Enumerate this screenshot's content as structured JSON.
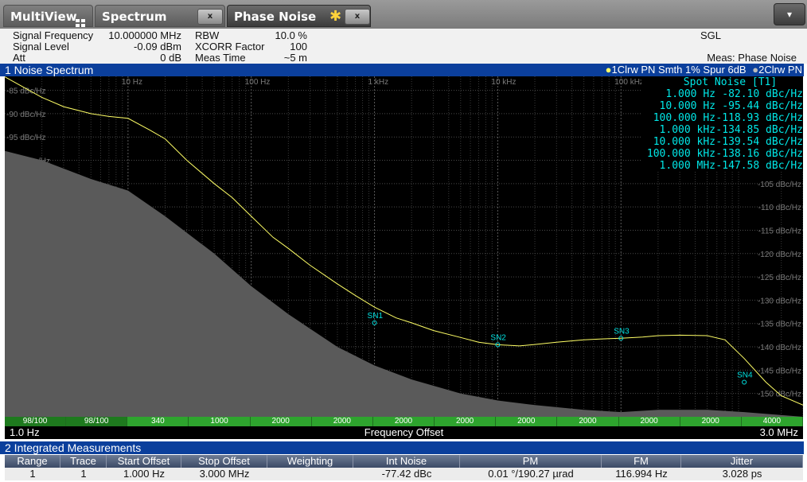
{
  "tabs": {
    "multiview": "MultiView",
    "multiview_icon": "grid-icon",
    "spectrum": "Spectrum",
    "phase_noise": "Phase Noise",
    "close_symbol": "x",
    "modified_icon": "asterisk-icon",
    "dropdown_symbol": "▾"
  },
  "info": {
    "signal_frequency_label": "Signal Frequency",
    "signal_frequency_value": "10.000000 MHz",
    "signal_level_label": "Signal Level",
    "signal_level_value": "-0.09 dBm",
    "att_label": "Att",
    "att_value": "0 dB",
    "rbw_label": "RBW",
    "rbw_value": "10.0 %",
    "xcorr_label": "XCORR Factor",
    "xcorr_value": "100",
    "meas_time_label": "Meas Time",
    "meas_time_value": "~5 m",
    "sweep_mode": "SGL",
    "meas_label": "Meas: Phase Noise"
  },
  "noise_window": {
    "title": "1 Noise Spectrum",
    "trace1_label": "1Clrw PN Smth 1% Spur 6dB",
    "trace2_label": "2Clrw PN"
  },
  "spot_noise": {
    "title": "Spot Noise [T1]",
    "rows": [
      {
        "offset": "1.000 Hz",
        "value": "-82.10 dBc/Hz"
      },
      {
        "offset": "10.000 Hz",
        "value": "-95.44 dBc/Hz"
      },
      {
        "offset": "100.000 Hz",
        "value": "-118.93 dBc/Hz"
      },
      {
        "offset": "1.000 kHz",
        "value": "-134.85 dBc/Hz"
      },
      {
        "offset": "10.000 kHz",
        "value": "-139.54 dBc/Hz"
      },
      {
        "offset": "100.000 kHz",
        "value": "-138.16 dBc/Hz"
      },
      {
        "offset": "1.000 MHz",
        "value": "-147.58 dBc/Hz"
      }
    ]
  },
  "rbw_bar": [
    "98/100",
    "98/100",
    "340",
    "1000",
    "2000",
    "2000",
    "2000",
    "2000",
    "2000",
    "2000",
    "2000",
    "2000",
    "4000"
  ],
  "footer": {
    "start": "1.0 Hz",
    "center": "Frequency Offset",
    "stop": "3.0 MHz"
  },
  "integrated": {
    "title": "2 Integrated Measurements",
    "columns": [
      "Range",
      "Trace",
      "Start Offset",
      "Stop Offset",
      "Weighting",
      "Int Noise",
      "PM",
      "FM",
      "Jitter"
    ],
    "rows": [
      [
        "1",
        "1",
        "1.000 Hz",
        "3.000 MHz",
        "",
        "-77.42 dBc",
        "0.01 °/190.27 µrad",
        "116.994 Hz",
        "3.028 ps"
      ]
    ]
  },
  "colors": {
    "trace1": "#ffff66",
    "noise_floor": "#5a5a5a",
    "marker": "#00e0e0",
    "title_bar": "#0b3f9c",
    "rbw_bar": "#2ea42e"
  },
  "chart_data": {
    "type": "line",
    "xscale": "log",
    "xlim": [
      1,
      3000000
    ],
    "ylim": [
      -155,
      -82
    ],
    "x_tick_labels": [
      "10 Hz",
      "100 Hz",
      "1 kHz",
      "10 kHz",
      "100 kHz"
    ],
    "x_tick_values": [
      10,
      100,
      1000,
      10000,
      100000
    ],
    "y_tick_labels": [
      "-85 dBc/Hz",
      "-90 dBc/Hz",
      "-95 dBc/Hz",
      "-100 dBc/Hz",
      "-105 dBc/Hz",
      "-110 dBc/Hz",
      "-115 dBc/Hz",
      "-120 dBc/Hz",
      "-125 dBc/Hz",
      "-130 dBc/Hz",
      "-135 dBc/Hz",
      "-140 dBc/Hz",
      "-145 dBc/Hz",
      "-150 dBc/Hz"
    ],
    "y_tick_values": [
      -85,
      -90,
      -95,
      -100,
      -105,
      -110,
      -115,
      -120,
      -125,
      -130,
      -135,
      -140,
      -145,
      -150
    ],
    "xlabel": "Frequency Offset",
    "series": [
      {
        "name": "1Clrw PN Smth 1% Spur 6dB",
        "x": [
          1,
          2,
          3,
          5,
          7,
          10,
          15,
          20,
          30,
          50,
          70,
          100,
          150,
          200,
          300,
          500,
          700,
          1000,
          1500,
          2000,
          3000,
          5000,
          7000,
          10000,
          15000,
          20000,
          30000,
          50000,
          70000,
          100000,
          150000,
          200000,
          300000,
          500000,
          700000,
          1000000,
          1500000,
          2000000,
          3000000
        ],
        "y": [
          -82.1,
          -86.5,
          -88.5,
          -90.0,
          -90.6,
          -91.0,
          -93.5,
          -95.4,
          -100.0,
          -105.0,
          -108.0,
          -112.0,
          -116.5,
          -118.9,
          -122.5,
          -126.5,
          -129.0,
          -131.5,
          -133.8,
          -134.85,
          -136.5,
          -138.0,
          -139.0,
          -139.54,
          -139.8,
          -139.5,
          -139.0,
          -138.5,
          -138.3,
          -138.16,
          -137.9,
          -137.6,
          -137.5,
          -137.6,
          -138.5,
          -142.5,
          -147.58,
          -150.5,
          -152.5
        ]
      },
      {
        "name": "noise floor",
        "x": [
          1,
          2,
          5,
          10,
          20,
          50,
          100,
          200,
          500,
          1000,
          2000,
          5000,
          10000,
          20000,
          50000,
          100000,
          200000,
          500000,
          1000000,
          3000000
        ],
        "y": [
          -98,
          -100,
          -104,
          -106.5,
          -112,
          -120,
          -127,
          -133,
          -140,
          -144,
          -147,
          -150,
          -151.5,
          -152.5,
          -153.5,
          -154,
          -153.5,
          -153.5,
          -154,
          -155
        ]
      }
    ],
    "markers": [
      {
        "label": "SN1",
        "x": 1000,
        "y": -134.85
      },
      {
        "label": "SN2",
        "x": 10000,
        "y": -139.54
      },
      {
        "label": "SN3",
        "x": 100000,
        "y": -138.16
      },
      {
        "label": "SN4",
        "x": 1000000,
        "y": -147.58
      }
    ]
  }
}
